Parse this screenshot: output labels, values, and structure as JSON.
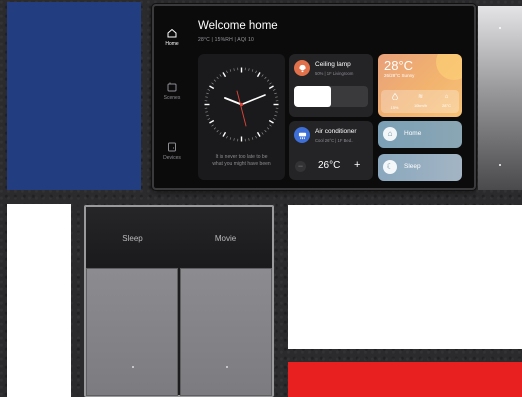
{
  "tablet": {
    "sidebar": [
      {
        "label": "Home",
        "icon": "home-icon",
        "active": true
      },
      {
        "label": "Scenes",
        "icon": "scenes-icon",
        "active": false
      },
      {
        "label": "Devices",
        "icon": "devices-icon",
        "active": false
      }
    ],
    "greeting": "Welcome home",
    "status_line": "28°C  |  15%RH  |  AQI 10",
    "clock": {
      "caption_line1": "It is never too late to be",
      "caption_line2": "what you might have been"
    },
    "lamp": {
      "title": "Ceiling lamp",
      "subtitle": "50%  |  1F Livingroom",
      "brightness_percent": 50,
      "icon": "lamp-icon"
    },
    "ac": {
      "title": "Air conditioner",
      "subtitle": "Cool 26°C  |  1F Bed..",
      "temp": "26°C",
      "plus": "+",
      "minus": "−",
      "icon": "ac-icon"
    },
    "weather": {
      "temp": "28°C",
      "range": "26/28°C  Sunny",
      "stats": [
        {
          "icon": "humidity-icon",
          "glyph": "💧",
          "value": "15%"
        },
        {
          "icon": "wind-icon",
          "glyph": "≋",
          "value": "10km/h"
        },
        {
          "icon": "indoor-temp-icon",
          "glyph": "⌂",
          "value": "28°C"
        }
      ]
    },
    "scenes": [
      {
        "label": "Home",
        "icon": "home-icon",
        "glyph": "⌂"
      },
      {
        "label": "Sleep",
        "icon": "moon-icon",
        "glyph": "☾"
      }
    ]
  },
  "switch_panel": {
    "left_label": "Sleep",
    "right_label": "Movie"
  },
  "colors": {
    "blue_panel": "#223d80",
    "red_block": "#e8201f",
    "lamp_icon": "#e0714a",
    "ac_icon": "#3d6fd6"
  }
}
